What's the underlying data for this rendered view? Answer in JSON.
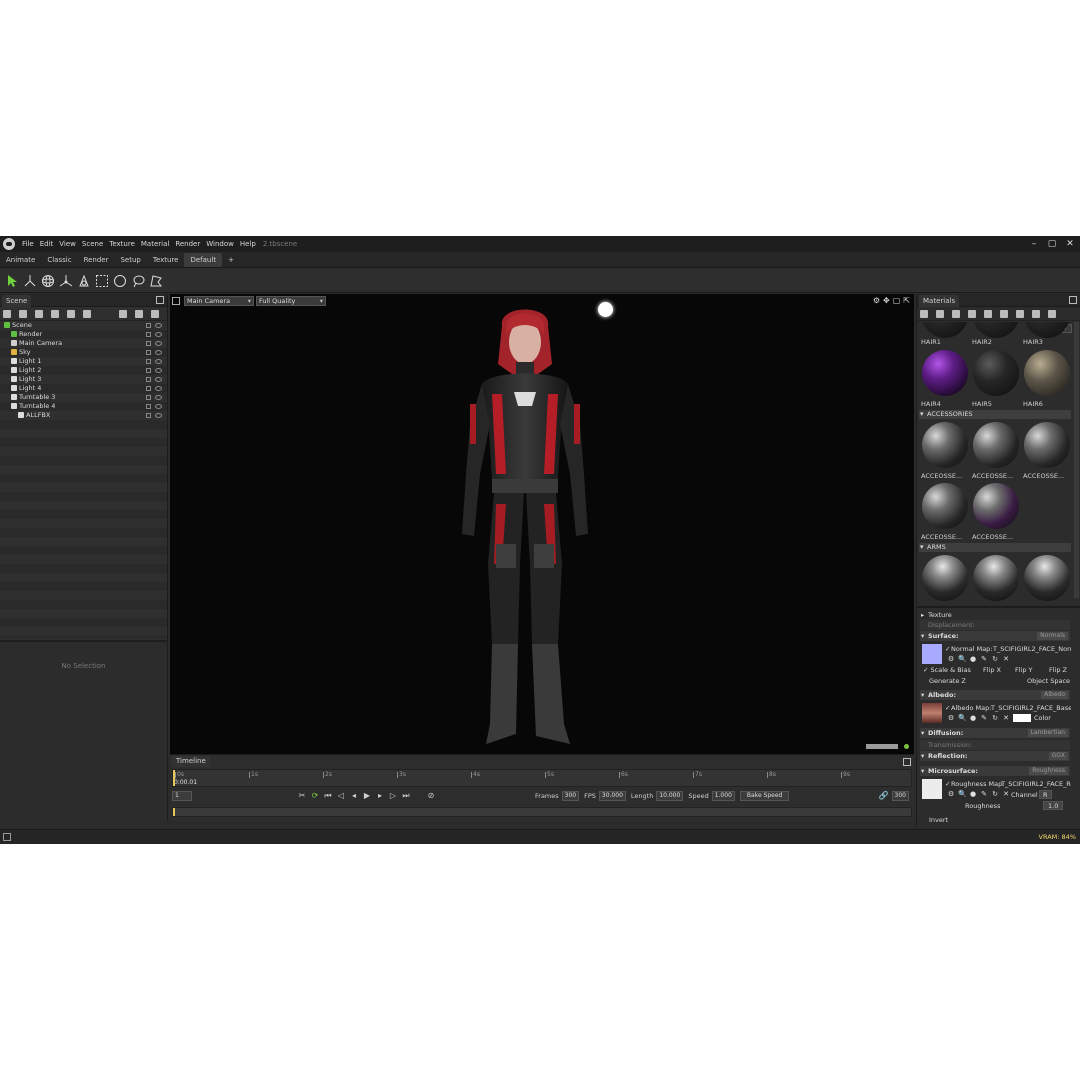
{
  "app": {
    "menus": [
      "File",
      "Edit",
      "View",
      "Scene",
      "Texture",
      "Material",
      "Render",
      "Window",
      "Help"
    ],
    "filename": "2.tbscene",
    "window_controls": [
      "minimize-icon",
      "maximize-icon",
      "close-icon"
    ]
  },
  "tabs": {
    "items": [
      "Animate",
      "Classic",
      "Render",
      "Setup",
      "Texture",
      "Default",
      "+"
    ],
    "active": "Default"
  },
  "toolbar": {
    "tools": [
      "select-arrow-icon",
      "move-icon",
      "rotate-icon",
      "transform-icon",
      "scale-icon",
      "rect-select-icon",
      "circle-select-icon",
      "lasso-icon",
      "polygon-select-icon"
    ]
  },
  "scene": {
    "tab_label": "Scene",
    "tree": [
      {
        "label": "Scene",
        "indent": 0,
        "icon": "scene-icon",
        "color": "#5fbf3f"
      },
      {
        "label": "Render",
        "indent": 1,
        "icon": "render-icon",
        "color": "#5fbf3f"
      },
      {
        "label": "Main Camera",
        "indent": 1,
        "icon": "camera-icon",
        "color": "#cfcfcf"
      },
      {
        "label": "Sky",
        "indent": 1,
        "icon": "sky-icon",
        "color": "#e0b040"
      },
      {
        "label": "Light 1",
        "indent": 1,
        "icon": "light-icon",
        "color": "#dddddd"
      },
      {
        "label": "Light 2",
        "indent": 1,
        "icon": "light-icon",
        "color": "#dddddd"
      },
      {
        "label": "Light 3",
        "indent": 1,
        "icon": "light-icon",
        "color": "#dddddd"
      },
      {
        "label": "Light 4",
        "indent": 1,
        "icon": "light-icon",
        "color": "#dddddd"
      },
      {
        "label": "Turntable 3",
        "indent": 1,
        "icon": "turntable-icon",
        "color": "#dddddd"
      },
      {
        "label": "Turntable 4",
        "indent": 1,
        "icon": "turntable-icon",
        "color": "#dddddd"
      },
      {
        "label": "ALLFBX",
        "indent": 2,
        "icon": "mesh-icon",
        "color": "#dddddd"
      }
    ],
    "no_selection": "No Selection"
  },
  "viewport": {
    "camera": "Main Camera",
    "quality": "Full Quality",
    "controls": [
      "gear-icon",
      "move-view-icon",
      "frame-icon",
      "popout-icon"
    ]
  },
  "timeline": {
    "title": "Timeline",
    "ticks": [
      "0s",
      "1s",
      "2s",
      "3s",
      "4s",
      "5s",
      "6s",
      "7s",
      "8s",
      "9s"
    ],
    "time": "0:00.01",
    "frame_field": "1",
    "frames_label": "Frames",
    "frames": "300",
    "fps_label": "FPS",
    "fps": "30.000",
    "length_label": "Length",
    "length": "10.000",
    "speed_label": "Speed",
    "speed": "1.000",
    "bake_speed": "Bake Speed",
    "end_frame": "300"
  },
  "materials": {
    "tab_label": "Materials",
    "hair_row1": [
      "HAIR1",
      "HAIR2",
      "HAIR3"
    ],
    "hair_row2": [
      {
        "label": "HAIR4",
        "style": "purple"
      },
      {
        "label": "HAIR5",
        "style": "hair"
      },
      {
        "label": "HAIR6",
        "style": "blonde"
      }
    ],
    "sections": {
      "accessories": "ACCESSORIES",
      "arms": "ARMS"
    },
    "accessories": [
      {
        "label": "ACCEOSSE...",
        "style": "acc"
      },
      {
        "label": "ACCEOSSE...",
        "style": "acc"
      },
      {
        "label": "ACCEOSSE...",
        "style": "acc"
      },
      {
        "label": "ACCEOSSE...",
        "style": "acc"
      },
      {
        "label": "ACCEOSSE...",
        "style": "accp"
      }
    ],
    "arms": [
      "arm",
      "arm",
      "arm"
    ]
  },
  "properties": {
    "texture": "Texture",
    "displacement": "Displacement:",
    "surface": {
      "label": "Surface:",
      "value": "Normals"
    },
    "normal_map": "Normal Map:",
    "normal_map_file": "T_SCIFIGIRL2_FACE_Norm",
    "scale_bias": "Scale & Bias",
    "flip_x": "Flip X",
    "flip_y": "Flip Y",
    "flip_z": "Flip Z",
    "generate_z": "Generate Z",
    "object_space": "Object Space",
    "albedo": {
      "label": "Albedo:",
      "value": "Albedo"
    },
    "albedo_map": "Albedo Map:",
    "albedo_map_file": "T_SCIFIGIRL2_FACE_Base_c",
    "color_label": "Color",
    "diffusion": {
      "label": "Diffusion:",
      "value": "Lambertian"
    },
    "transmission": "Transmission:",
    "reflection": {
      "label": "Reflection:",
      "value": "GGX"
    },
    "microsurface": {
      "label": "Microsurface:",
      "value": "Roughness"
    },
    "roughness_map": "Roughness Map:",
    "roughness_map_file": "T_SCIFIGIRL2_FACE_Ro",
    "channel_label": "Channel",
    "channel": "R",
    "roughness_label": "Roughness",
    "roughness": "1.0",
    "invert": "Invert"
  },
  "status": {
    "vram": "VRAM: 84%"
  },
  "colors": {
    "accent_yellow": "#f2d96a",
    "normal_swatch": "#a9a9ff"
  }
}
